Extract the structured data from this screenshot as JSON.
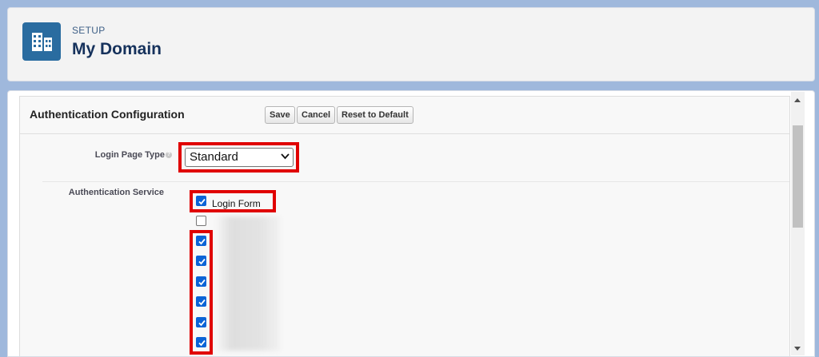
{
  "header": {
    "section_label": "SETUP",
    "title": "My Domain",
    "icon": "building-icon"
  },
  "panel": {
    "title": "Authentication Configuration",
    "buttons": {
      "save": "Save",
      "cancel": "Cancel",
      "reset": "Reset to Default"
    }
  },
  "form": {
    "login_page_type": {
      "label": "Login Page Type",
      "help_icon": "help-icon",
      "selected": "Standard"
    },
    "auth_service": {
      "label": "Authentication Service",
      "login_form": {
        "label": "Login Form",
        "checked": true
      },
      "options_checked": [
        false,
        true,
        true,
        true,
        true,
        true,
        true
      ]
    }
  },
  "colors": {
    "highlight": "#e00000",
    "checkbox_checked": "#0b64d6",
    "app_icon_bg": "#2a6ca0",
    "page_bg": "#9fb8dc"
  }
}
